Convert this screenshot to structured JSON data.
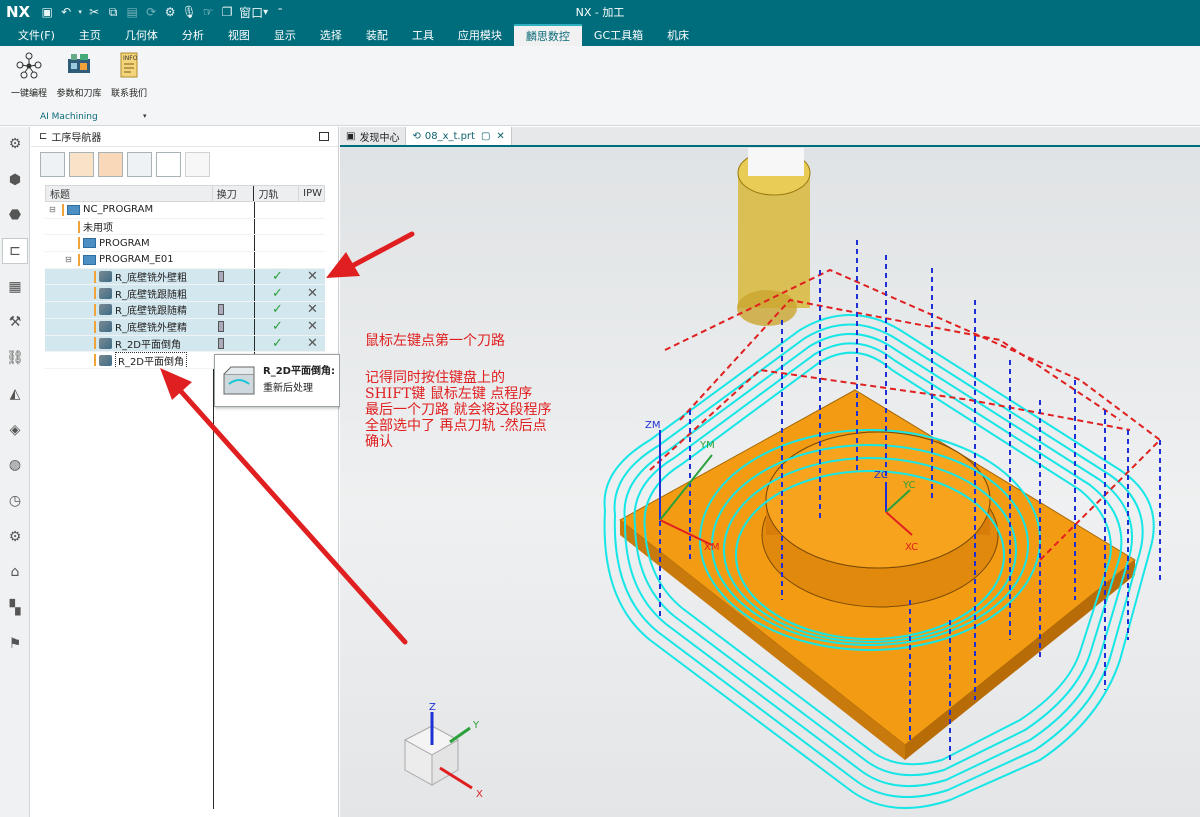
{
  "app": {
    "logo": "NX",
    "title": "NX - 加工"
  },
  "quick_access": {
    "window_label": "窗口",
    "icons": [
      "save-icon",
      "undo-icon",
      "cut-icon",
      "copy-icon",
      "paste-icon",
      "repeat-icon",
      "toolbox-icon",
      "mic-icon",
      "touch-icon",
      "window-icon"
    ]
  },
  "menu": [
    "文件(F)",
    "主页",
    "几何体",
    "分析",
    "视图",
    "显示",
    "选择",
    "装配",
    "工具",
    "应用模块",
    "麟思数控",
    "GC工具箱",
    "机床"
  ],
  "menu_active": "麟思数控",
  "ribbon": {
    "buttons": [
      {
        "label": "一键编程",
        "icon": "network-icon"
      },
      {
        "label": "参数和刀库",
        "icon": "board-icon"
      },
      {
        "label": "联系我们",
        "icon": "info-icon"
      }
    ],
    "group_label": "AI Machining"
  },
  "left_toolbar": [
    "settings-icon",
    "part-icon",
    "assembly-icon",
    "operation-navigator-icon",
    "table-icon",
    "tool-icon",
    "path-icon",
    "measure-icon",
    "feature-icon",
    "globe-icon",
    "history-icon",
    "settings-tool-icon",
    "machine-icon",
    "palette-icon",
    "robot-icon"
  ],
  "navigator": {
    "title": "工序导航器",
    "toolbar_icons": [
      "program-view-icon",
      "machine-view-icon",
      "geometry-view-icon",
      "method-view-icon",
      "create-icon",
      "delete-icon"
    ],
    "columns": {
      "name": "标题",
      "tool": "换刀",
      "path": "刀轨",
      "ipw": "IPW"
    },
    "rows": [
      {
        "name": "NC_PROGRAM",
        "kind": "folder",
        "indent": 0
      },
      {
        "name": "未用项",
        "kind": "plain",
        "indent": 1
      },
      {
        "name": "PROGRAM",
        "kind": "folder",
        "indent": 1
      },
      {
        "name": "PROGRAM_E01",
        "kind": "folder",
        "indent": 1
      },
      {
        "name": "R_底壁铣外壁粗",
        "kind": "op",
        "indent": 2,
        "tool": true,
        "path": true,
        "ipw": true,
        "selected": true
      },
      {
        "name": "R_底壁铣跟随粗",
        "kind": "op",
        "indent": 2,
        "tool": false,
        "path": true,
        "ipw": true,
        "selected": true
      },
      {
        "name": "R_底壁铣跟随精",
        "kind": "op",
        "indent": 2,
        "tool": true,
        "path": true,
        "ipw": true,
        "selected": true
      },
      {
        "name": "R_底壁铣外壁精",
        "kind": "op",
        "indent": 2,
        "tool": true,
        "path": true,
        "ipw": true,
        "selected": true
      },
      {
        "name": "R_2D平面倒角",
        "kind": "op",
        "indent": 2,
        "tool": true,
        "path": true,
        "ipw": true,
        "selected": true
      },
      {
        "name": "R_2D平面倒角",
        "kind": "op",
        "indent": 2,
        "tool": false,
        "path": false,
        "ipw": false,
        "selected": false
      }
    ]
  },
  "tooltip": {
    "title": "R_2D平面倒角:",
    "subtitle": "重新后处理"
  },
  "tabs": [
    {
      "label": "发现中心"
    },
    {
      "label": "08_x_t.prt"
    }
  ],
  "annotations": {
    "line1": "鼠标左键点第一个刀路",
    "block": [
      "记得同时按住键盘上的",
      "SHIFT键 鼠标左键 点程序",
      "最后一个刀路 就会将这段程序",
      "全部选中了 再点刀轨 -然后点",
      "确认"
    ]
  },
  "axes": {
    "zm": "ZM",
    "ym": "YM",
    "xm": "XM",
    "zc": "ZC",
    "yc": "YC",
    "xc": "XC",
    "z": "Z",
    "y": "Y",
    "x": "X"
  },
  "colors": {
    "titlebar": "#006d7c",
    "toolpath": "#16e6e6",
    "part": "#f39b12",
    "arrow": "#e02020",
    "retract": "#1e2fd6",
    "rapid": "#e02020"
  }
}
